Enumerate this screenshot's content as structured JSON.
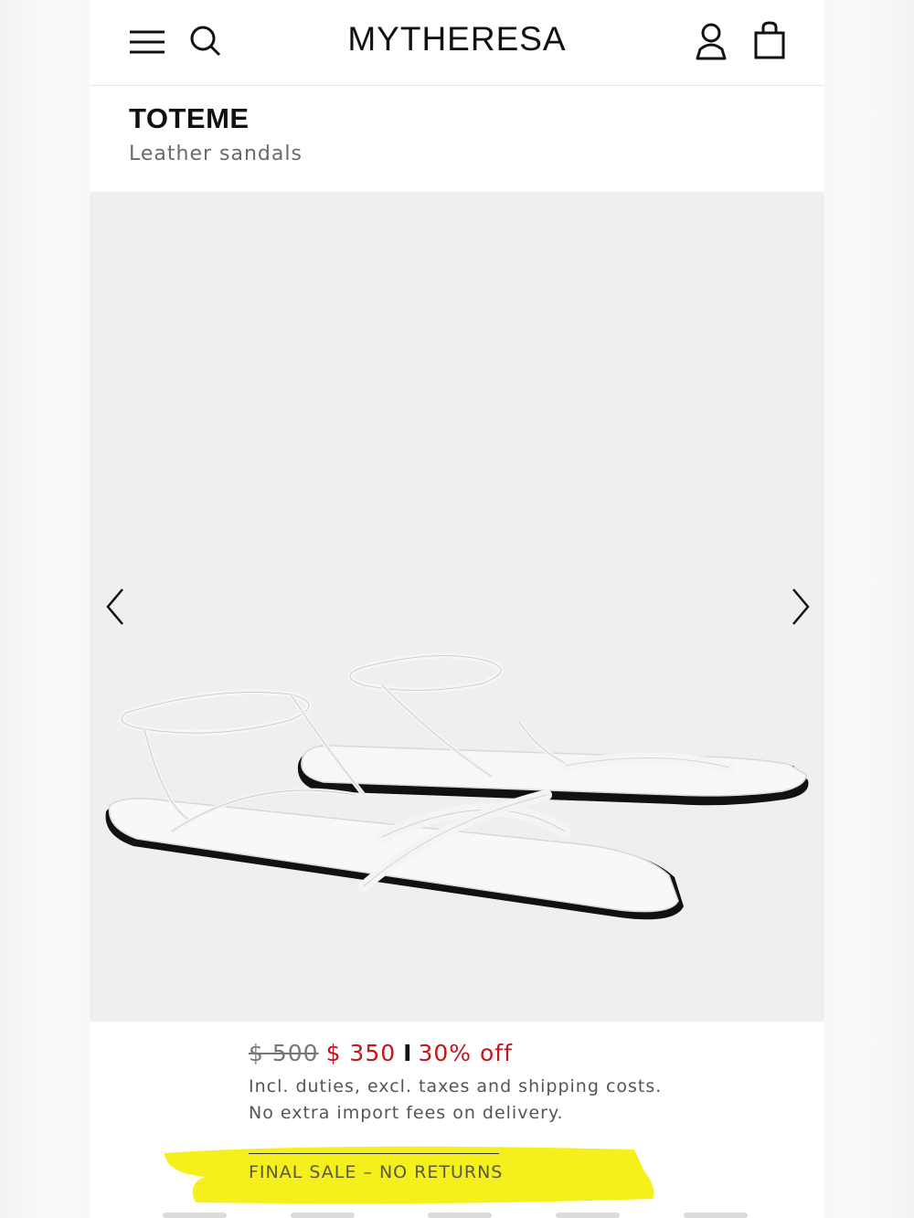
{
  "header": {
    "logo": "MYTHERESA",
    "icons": [
      "menu-icon",
      "search-icon",
      "account-icon",
      "bag-icon"
    ]
  },
  "product": {
    "brand": "TOTEME",
    "name": "Leather sandals",
    "image": "white leather lace-up flat sandals"
  },
  "gallery": {
    "prev_icon": "chevron-left-icon",
    "next_icon": "chevron-right-icon"
  },
  "price": {
    "original": "$ 500",
    "sale": "$ 350",
    "separator": "I",
    "discount": "30% off",
    "note_1": "Incl. duties, excl. taxes and shipping costs.",
    "note_2": "No extra import fees on delivery."
  },
  "notice": {
    "final_sale": "FINAL SALE – NO RETURNS",
    "highlight_color": "#f5ef1c"
  },
  "colors": {
    "sale_red": "#c3161c",
    "gallery_bg": "#efefef"
  }
}
